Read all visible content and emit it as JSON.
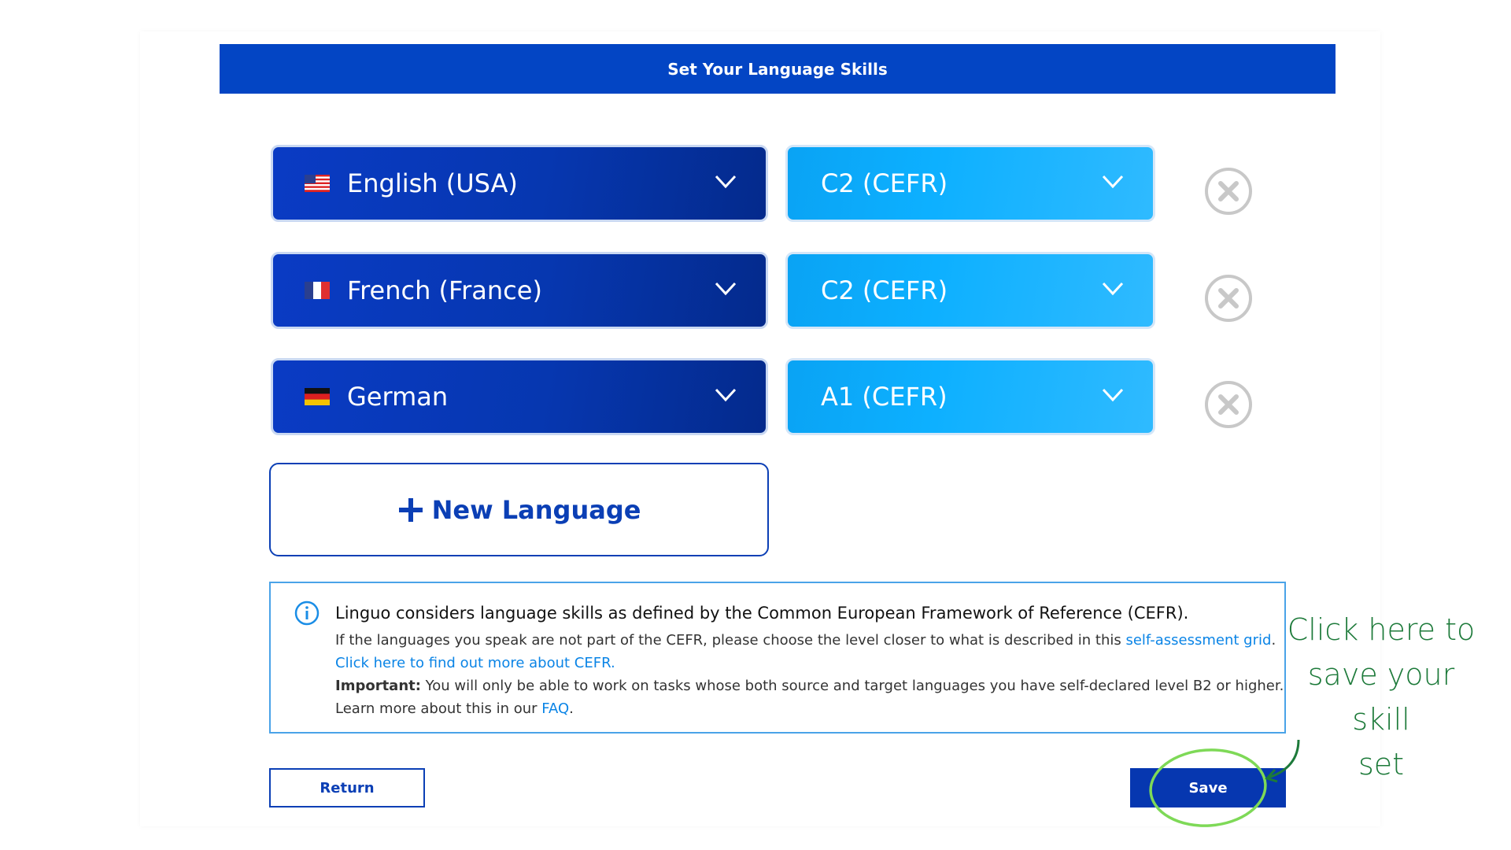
{
  "header": {
    "title": "Set Your Language Skills"
  },
  "rows": [
    {
      "language": "English (USA)",
      "flag": "us-flag-icon",
      "level": "C2 (CEFR)"
    },
    {
      "language": "French (France)",
      "flag": "fr-flag-icon",
      "level": "C2 (CEFR)"
    },
    {
      "language": "German",
      "flag": "de-flag-icon",
      "level": "A1 (CEFR)"
    }
  ],
  "new_language": {
    "icon": "plus-icon",
    "label": "New Language"
  },
  "info": {
    "icon": "info-icon",
    "main": "Linguo considers language skills as defined by the Common European Framework of Reference (CEFR).",
    "line1_text": "If the languages you speak are not part of the CEFR, please choose the level closer to what is described in this ",
    "line1_link": "self-assessment grid",
    "line1_end": ".",
    "line2_link": "Click here to find out more about CEFR.",
    "line3_bold": "Important:",
    "line3_text": " You will only be able to work on tasks whose both source and target languages you have self-declared level B2 or higher.",
    "line4_text": "Learn more about this in our ",
    "line4_link": "FAQ",
    "line4_end": "."
  },
  "buttons": {
    "return": "Return",
    "save": "Save"
  },
  "annotation": {
    "line1": "Click here to",
    "line2": "save your skill",
    "line3": "set"
  },
  "colors": {
    "primary": "#0345c4",
    "level_blue": "#0db0ff",
    "link": "#0a84e6",
    "annotation_green": "#1d7a3a",
    "circle_green": "#7ed957"
  }
}
